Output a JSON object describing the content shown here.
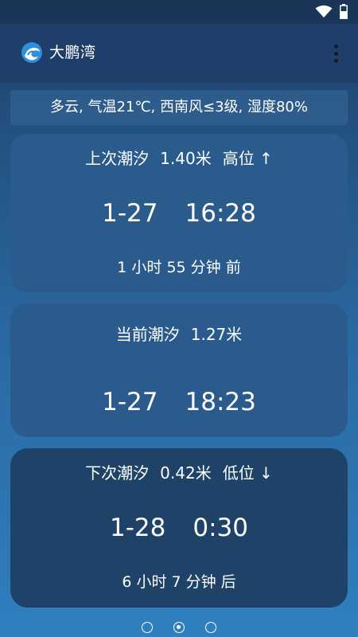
{
  "status_bar": {
    "wifi_icon": "wifi-icon",
    "battery_icon": "battery-icon"
  },
  "app_bar": {
    "title": "大鹏湾",
    "logo_icon": "wave-logo-icon",
    "menu_icon": "more-vert-icon"
  },
  "weather": {
    "summary": "多云, 气温21℃, 西南风≤3级, 湿度80%"
  },
  "cards": [
    {
      "label": "上次潮汐",
      "height": "1.40米",
      "level": "高位 ↑",
      "date": "1-27",
      "time": "16:28",
      "relative": "1 小时 55 分钟 前"
    },
    {
      "label": "当前潮汐",
      "height": "1.27米",
      "date": "1-27",
      "time": "18:23"
    },
    {
      "label": "下次潮汐",
      "height": "0.42米",
      "level": "低位 ↓",
      "date": "1-28",
      "time": "0:30",
      "relative": "6 小时 7 分钟 后"
    }
  ],
  "pager": {
    "page_count": 3,
    "active_index": 1
  },
  "colors": {
    "app_bar": "#1f3e69",
    "status_bar": "#1b3558",
    "card": "#2a5b8c",
    "card_dark": "#1f4268",
    "text": "#ffffff"
  }
}
